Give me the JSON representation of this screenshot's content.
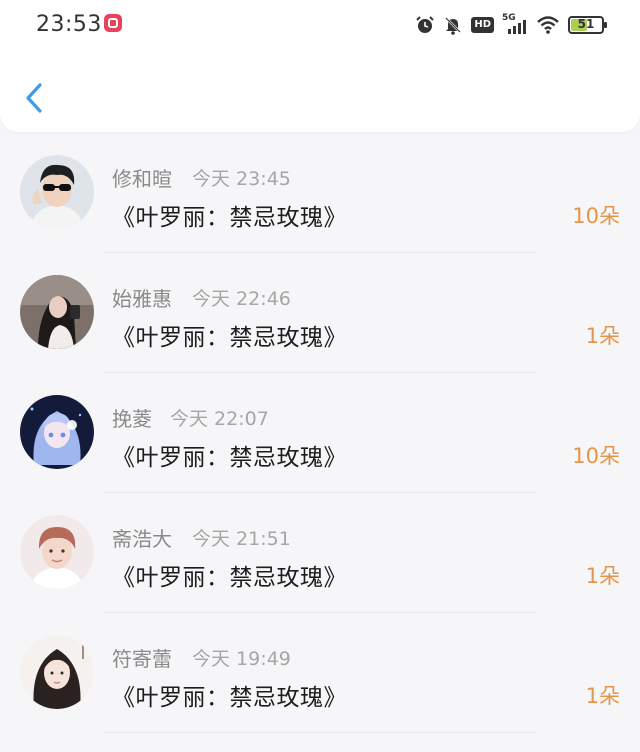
{
  "status_bar": {
    "time": "23:53",
    "network": "5G",
    "hd": "HD",
    "battery": "51"
  },
  "list": [
    {
      "name": "修和暄",
      "time": "今天 23:45",
      "gift": "《叶罗丽：禁忌玫瑰》",
      "amount": "10朵"
    },
    {
      "name": "始雅惠",
      "time": "今天 22:46",
      "gift": "《叶罗丽：禁忌玫瑰》",
      "amount": "1朵"
    },
    {
      "name": "挽菱",
      "time": "今天 22:07",
      "gift": "《叶罗丽：禁忌玫瑰》",
      "amount": "10朵"
    },
    {
      "name": "斋浩大",
      "time": "今天 21:51",
      "gift": "《叶罗丽：禁忌玫瑰》",
      "amount": "1朵"
    },
    {
      "name": "符寄蕾",
      "time": "今天 19:49",
      "gift": "《叶罗丽：禁忌玫瑰》",
      "amount": "1朵"
    }
  ],
  "icons": {
    "back": "chevron-left-icon"
  },
  "colors": {
    "accent_blue": "#3e9be8",
    "amount_orange": "#e59548"
  }
}
